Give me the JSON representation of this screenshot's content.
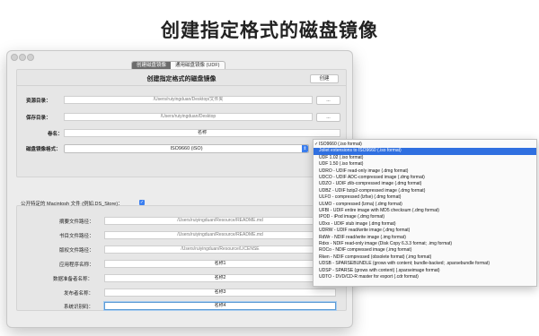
{
  "headline": "创建指定格式的磁盘镜像",
  "tabs": [
    {
      "label": "创建磁盘镜像",
      "active": true
    },
    {
      "label": "通用磁盘镜像 (UDF)",
      "active": false
    }
  ],
  "panel1": {
    "title": "创建指定格式的磁盘镜像",
    "create_button": "创建",
    "source_label": "资源目录：",
    "source_value": "/Users/ruiyingduan/Desktop/文件夹",
    "source_browse": "...",
    "save_label": "保存目录：",
    "save_value": "/Users/ruiyingduan/Desktop",
    "save_browse": "...",
    "volume_label": "卷名：",
    "volume_value": "名称",
    "format_label": "磁盘镜像格式：",
    "format_value": "ISO9660 (iSO)"
  },
  "panel2": {
    "public_label": "公开特定的 Macintosh 文件 (例如.DS_Store)：",
    "rows": [
      {
        "label": "摘要文件路径：",
        "value": "/Users/ruiyingduan/Resource/README.md"
      },
      {
        "label": "书目文件路径：",
        "value": "/Users/ruiyingduan/Resource/README.md"
      },
      {
        "label": "版权文件路径：",
        "value": "/Users/ruiyingduan/Resource/LICENSE"
      },
      {
        "label": "应用程序名称：",
        "value": "名称1"
      },
      {
        "label": "数据准备者名称：",
        "value": "名称2"
      },
      {
        "label": "发布者名称：",
        "value": "名称3"
      },
      {
        "label": "系统识别码：",
        "value": "名称4"
      }
    ]
  },
  "format_options": [
    {
      "label": "ISO9660 (.iso format)",
      "checked": true,
      "selected": false
    },
    {
      "label": "Joliet extensions to ISO9660 (.iso format)",
      "checked": false,
      "selected": true
    },
    {
      "label": "UDF 1.02 (.iso format)",
      "checked": false,
      "selected": false
    },
    {
      "label": "UDF 1.50 (.iso format)",
      "checked": false,
      "selected": false
    },
    {
      "label": "UDRO - UDIF read-only image (.dmg format)",
      "checked": false,
      "selected": false
    },
    {
      "label": "UDCO - UDIF ADC-compressed image (.dmg format)",
      "checked": false,
      "selected": false
    },
    {
      "label": "UDZO - UDIF zlib-compressed image (.dmg format)",
      "checked": false,
      "selected": false
    },
    {
      "label": "UDBZ - UDIF bzip2-compressed image (.dmg format)",
      "checked": false,
      "selected": false
    },
    {
      "label": "ULFO - compressed (lzfse) (.dmg format)",
      "checked": false,
      "selected": false
    },
    {
      "label": "ULMO - compressed (lzma) (.dmg format)",
      "checked": false,
      "selected": false
    },
    {
      "label": "UFBI - UDIF entire image with MD5 checksum (.dmg format)",
      "checked": false,
      "selected": false
    },
    {
      "label": "IPOD - iPod image (.dmg format)",
      "checked": false,
      "selected": false
    },
    {
      "label": "UDxx - UDIF stub image (.dmg format)",
      "checked": false,
      "selected": false
    },
    {
      "label": "UDRW - UDIF read/write image (.dmg format)",
      "checked": false,
      "selected": false
    },
    {
      "label": "RdWr - NDIF read/write image (.img format)",
      "checked": false,
      "selected": false
    },
    {
      "label": "Rdxx - NDIF read-only image (Disk Copy 6.3.3 format; .img format)",
      "checked": false,
      "selected": false
    },
    {
      "label": "ROCo - NDIF compressed image (.img format)",
      "checked": false,
      "selected": false
    },
    {
      "label": "Rken - NDIF compressed (obsolete format) (.img format)",
      "checked": false,
      "selected": false
    },
    {
      "label": "UDSB - SPARSEBUNDLE (grows with content; bundle-backed; .sparsebundle format)",
      "checked": false,
      "selected": false
    },
    {
      "label": "UDSP - SPARSE (grows with content) (.sparseimage format)",
      "checked": false,
      "selected": false
    },
    {
      "label": "UDTO - DVD/CD-R master for export (.cdr format)",
      "checked": false,
      "selected": false
    }
  ],
  "colors": {
    "accent": "#3b7ff0",
    "selection": "#2f6fe0",
    "window_bg": "#ececec"
  }
}
